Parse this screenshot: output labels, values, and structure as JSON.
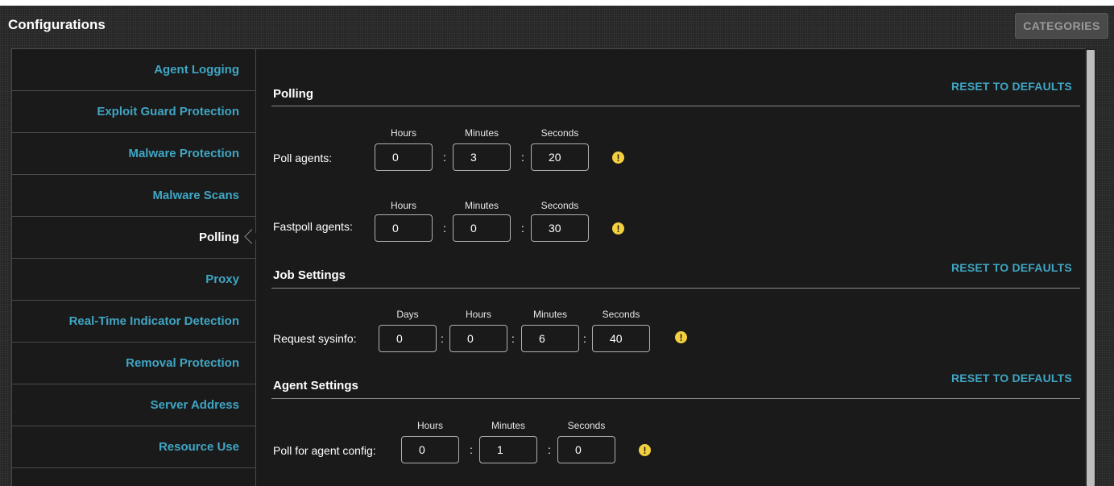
{
  "header": {
    "title": "Configurations",
    "categories_label": "CATEGORIES"
  },
  "sidebar": {
    "items": [
      {
        "label": "Agent Logging"
      },
      {
        "label": "Exploit Guard Protection"
      },
      {
        "label": "Malware Protection"
      },
      {
        "label": "Malware Scans"
      },
      {
        "label": "Polling",
        "active": true
      },
      {
        "label": "Proxy"
      },
      {
        "label": "Real-Time Indicator Detection"
      },
      {
        "label": "Removal Protection"
      },
      {
        "label": "Server Address"
      },
      {
        "label": "Resource Use"
      }
    ]
  },
  "reset_label": "RESET TO DEFAULTS",
  "colors": {
    "accent": "#3fa6c4",
    "warning": "#f4d03f",
    "background": "#1a1a1a"
  },
  "warning_icon": "!",
  "sections": {
    "polling": {
      "title": "Polling",
      "poll_agents": {
        "label": "Poll agents:",
        "units": [
          "Hours",
          "Minutes",
          "Seconds"
        ],
        "values": [
          "0",
          "3",
          "20"
        ]
      },
      "fastpoll_agents": {
        "label": "Fastpoll agents:",
        "units": [
          "Hours",
          "Minutes",
          "Seconds"
        ],
        "values": [
          "0",
          "0",
          "30"
        ]
      }
    },
    "job_settings": {
      "title": "Job Settings",
      "request_sysinfo": {
        "label": "Request sysinfo:",
        "units": [
          "Days",
          "Hours",
          "Minutes",
          "Seconds"
        ],
        "values": [
          "0",
          "0",
          "6",
          "40"
        ]
      }
    },
    "agent_settings": {
      "title": "Agent Settings",
      "poll_agent_config": {
        "label": "Poll for agent config:",
        "units": [
          "Hours",
          "Minutes",
          "Seconds"
        ],
        "values": [
          "0",
          "1",
          "0"
        ]
      }
    }
  },
  "separator": ":"
}
